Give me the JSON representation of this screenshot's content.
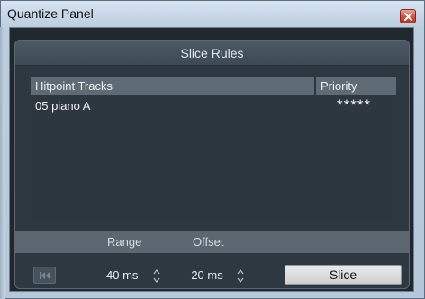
{
  "window": {
    "title": "Quantize Panel"
  },
  "panel": {
    "title": "Slice Rules"
  },
  "table": {
    "columns": [
      "Hitpoint Tracks",
      "Priority"
    ],
    "rows": [
      {
        "name": "05 piano A",
        "priority": "*****"
      }
    ]
  },
  "controls": {
    "range_label": "Range",
    "offset_label": "Offset",
    "range_value": "40 ms",
    "offset_value": "-20 ms",
    "slice_label": "Slice"
  },
  "icons": {
    "close": "close-icon",
    "skip_back": "skip-back-icon",
    "stepper": "up-down-stepper-icon"
  },
  "colors": {
    "panel_bg": "#2d3841",
    "header_bg": "#5e6a74",
    "close_btn": "#d4503a"
  }
}
